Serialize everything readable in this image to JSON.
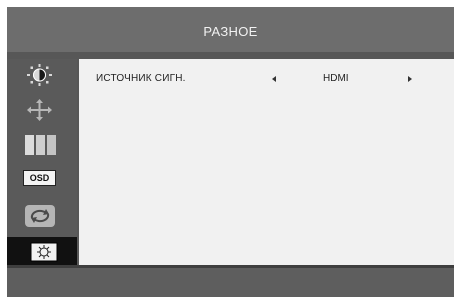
{
  "header": {
    "title": "РАЗНОЕ"
  },
  "sidebar": {
    "items": [
      {
        "icon": "brightness-icon"
      },
      {
        "icon": "position-icon"
      },
      {
        "icon": "color-bars-icon"
      },
      {
        "icon": "osd-icon",
        "label": "OSD"
      },
      {
        "icon": "reset-icon"
      },
      {
        "icon": "settings-gear-icon",
        "selected": true
      }
    ]
  },
  "main": {
    "options": [
      {
        "label": "ИСТОЧНИК СИГН.",
        "value": "HDMI"
      }
    ]
  },
  "colors": {
    "background": "#575757",
    "header": "#6d6d6d",
    "content": "#f1f1f1",
    "selected": "#111111"
  }
}
